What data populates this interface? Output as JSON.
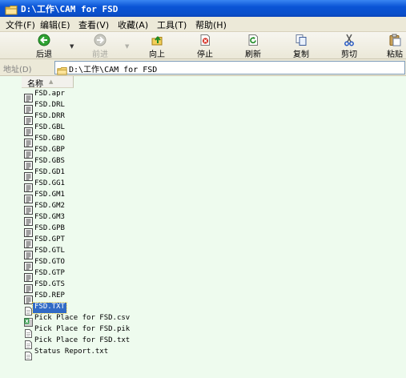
{
  "window": {
    "title": "D:\\工作\\CAM for FSD"
  },
  "menu": [
    "文件(F)",
    "编辑(E)",
    "查看(V)",
    "收藏(A)",
    "工具(T)",
    "帮助(H)"
  ],
  "toolbar": {
    "back": "后退",
    "forward": "前进",
    "up": "向上",
    "stop": "停止",
    "refresh": "刷新",
    "copy": "复制",
    "cut": "剪切",
    "paste": "粘贴"
  },
  "address": {
    "label": "地址(D)",
    "path": "D:\\工作\\CAM for FSD"
  },
  "list": {
    "column_name": "名称",
    "selected": "FSD.TXT",
    "files": [
      {
        "name": "FSD.apr",
        "icon": "doc-lines-icon"
      },
      {
        "name": "FSD.DRL",
        "icon": "doc-lines-icon"
      },
      {
        "name": "FSD.DRR",
        "icon": "doc-lines-icon"
      },
      {
        "name": "FSD.GBL",
        "icon": "doc-lines-icon"
      },
      {
        "name": "FSD.GBO",
        "icon": "doc-lines-icon"
      },
      {
        "name": "FSD.GBP",
        "icon": "doc-lines-icon"
      },
      {
        "name": "FSD.GBS",
        "icon": "doc-lines-icon"
      },
      {
        "name": "FSD.GD1",
        "icon": "doc-lines-icon"
      },
      {
        "name": "FSD.GG1",
        "icon": "doc-lines-icon"
      },
      {
        "name": "FSD.GM1",
        "icon": "doc-lines-icon"
      },
      {
        "name": "FSD.GM2",
        "icon": "doc-lines-icon"
      },
      {
        "name": "FSD.GM3",
        "icon": "doc-lines-icon"
      },
      {
        "name": "FSD.GPB",
        "icon": "doc-lines-icon"
      },
      {
        "name": "FSD.GPT",
        "icon": "doc-lines-icon"
      },
      {
        "name": "FSD.GTL",
        "icon": "doc-lines-icon"
      },
      {
        "name": "FSD.GTO",
        "icon": "doc-lines-icon"
      },
      {
        "name": "FSD.GTP",
        "icon": "doc-lines-icon"
      },
      {
        "name": "FSD.GTS",
        "icon": "doc-lines-icon"
      },
      {
        "name": "FSD.REP",
        "icon": "doc-lines-icon"
      },
      {
        "name": "FSD.TXT",
        "icon": "text-file-icon"
      },
      {
        "name": "Pick Place for FSD.csv",
        "icon": "spreadsheet-icon"
      },
      {
        "name": "Pick Place for FSD.pik",
        "icon": "text-file-icon"
      },
      {
        "name": "Pick Place for FSD.txt",
        "icon": "text-file-icon"
      },
      {
        "name": "Status Report.txt",
        "icon": "text-file-icon"
      }
    ]
  },
  "colors": {
    "title_blue": "#0a54d6",
    "content_bg": "#eefbee",
    "selection": "#316ac5",
    "menu_bg": "#ece9d8"
  }
}
